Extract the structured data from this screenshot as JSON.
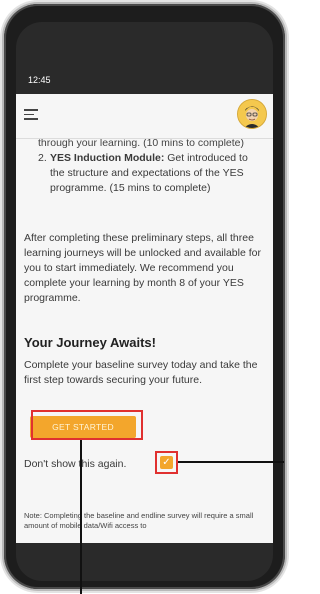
{
  "status_bar": {
    "time": "12:45"
  },
  "header": {
    "menu_icon": "hamburger-menu-icon",
    "avatar_icon": "user-avatar-icon"
  },
  "list": {
    "item1_partial": "through your learning. (10 mins to complete)",
    "item2_number": "2.",
    "item2_title": "YES Induction Module:",
    "item2_text": " Get introduced to the structure and expectations of the YES programme. (15 mins to complete)"
  },
  "paragraph": "After completing these preliminary steps, all three learning journeys will be unlocked and available for you to start immediately. We recommend you complete your learning by month 8 of your YES programme.",
  "journey": {
    "title": "Your Journey Awaits!",
    "body": "Complete your baseline survey today and take the first step towards securing your future."
  },
  "cta": {
    "label": "GET STARTED"
  },
  "dont_show": {
    "label": "Don't show this again.",
    "checked": true
  },
  "note": "Note: Completing the baseline and endline survey will require a small amount of mobile data/Wifi access to",
  "colors": {
    "accent": "#f3a62c",
    "highlight": "#e0302f",
    "background": "#f6f6f6"
  }
}
